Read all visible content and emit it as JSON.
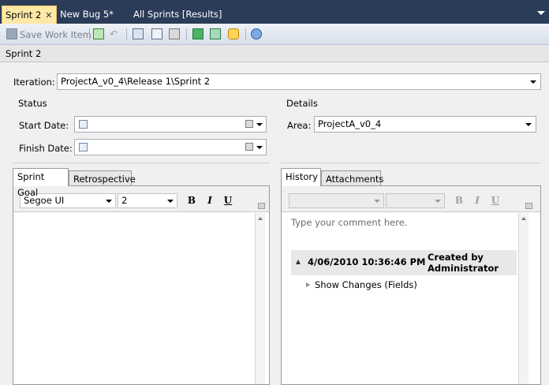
{
  "tabs": [
    {
      "label": "Sprint 2",
      "active": true
    },
    {
      "label": "New Bug 5*",
      "active": false
    },
    {
      "label": "All Sprints [Results]",
      "active": false
    }
  ],
  "toolbar": {
    "save_label": "Save Work Item",
    "icons": [
      "refresh-icon",
      "undo-icon",
      "new-linked-item-icon",
      "copy-icon",
      "capture-icon",
      "excel-icon",
      "project-icon",
      "outlook-icon",
      "help-icon"
    ]
  },
  "breadcrumb": "Sprint 2",
  "iteration": {
    "label": "Iteration:",
    "value": "ProjectA_v0_4\\Release 1\\Sprint 2"
  },
  "status": {
    "title": "Status",
    "start_label": "Start Date:",
    "finish_label": "Finish Date:"
  },
  "details": {
    "title": "Details",
    "area_label": "Area:",
    "area_value": "ProjectA_v0_4"
  },
  "left_pane": {
    "tabs": [
      "Sprint Goal",
      "Retrospective"
    ],
    "font_name": "Segoe UI",
    "font_size": "2",
    "bold": "B",
    "italic": "I",
    "underline": "U"
  },
  "right_pane": {
    "tabs": [
      "History",
      "Attachments"
    ],
    "bold": "B",
    "italic": "I",
    "underline": "U",
    "comment_placeholder": "Type your comment here.",
    "history_entry": {
      "timestamp": "4/06/2010 10:36:46 PM",
      "author_line1": "Created by",
      "author_line2": "Administrator",
      "changes_label": "Show Changes (Fields)"
    }
  },
  "colors": {
    "tabstrip_bg": "#2b3c59",
    "active_tab_bg": "#ffe8a6",
    "history_header_bg": "#e8e8e8"
  }
}
